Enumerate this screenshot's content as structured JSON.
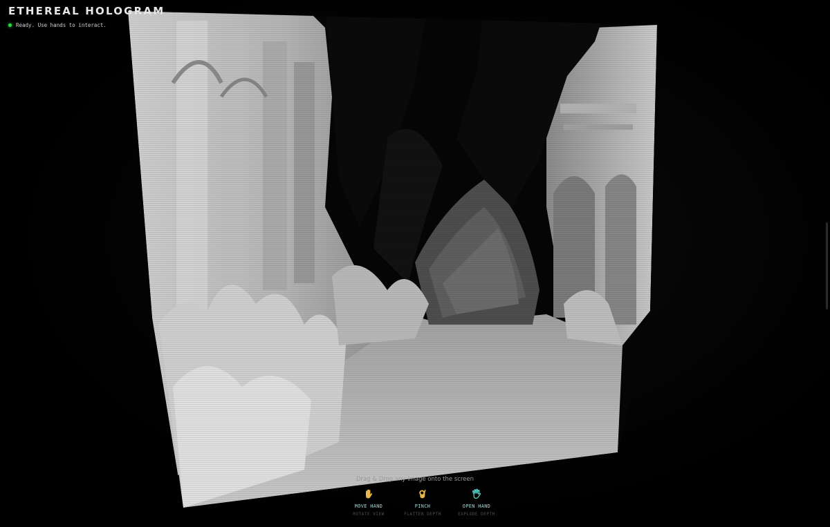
{
  "app": {
    "title": "ETHEREAL HOLOGRAM",
    "status": "Ready. Use hands to interact.",
    "status_color": "#2bd94a"
  },
  "hint": "Drag & Drop any image onto the screen",
  "gestures": [
    {
      "icon": "open-palm-hand-icon",
      "name": "MOVE HAND",
      "description": "ROTATE VIEW",
      "color": "#e8b84a"
    },
    {
      "icon": "pinch-hand-icon",
      "name": "PINCH",
      "description": "FLATTEN DEPTH",
      "color": "#e8b84a"
    },
    {
      "icon": "spread-hand-icon",
      "name": "OPEN HAND",
      "description": "EXPLODE DEPTH",
      "color": "#5fd6cf"
    }
  ],
  "colors": {
    "background": "#000000",
    "text": "#e6e6e6",
    "accent_name": "#a8d9d6",
    "description": "#4f4f4f"
  }
}
